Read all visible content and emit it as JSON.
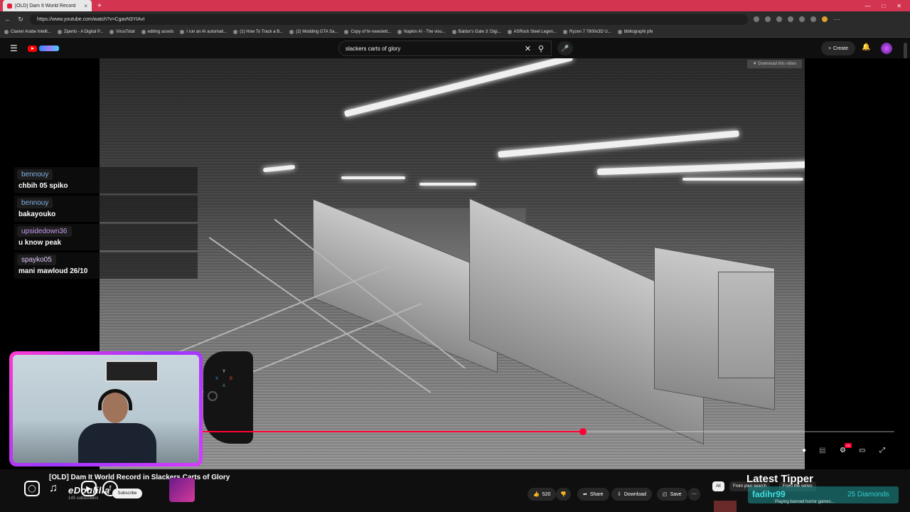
{
  "browser": {
    "tab_title": "[OLD] Dam It World Record",
    "tab_close": "×",
    "new_tab": "+",
    "url": "https://www.youtube.com/watch?v=CgavN3YIAvI",
    "bookmarks": [
      "Clavier Arabe Intelli...",
      "Ziperto - A Digital P...",
      "VirusTotal",
      "editing assets",
      "I run an AI automati...",
      "(1) How To Track a B...",
      "(2) Modding GTA Sa...",
      "Copy of hr-newslett...",
      "Napkin AI - The visu...",
      "Baldur's Gate 3: Digi...",
      "ASRock Steel Legen...",
      "Ryzen 7 7800x3D U...",
      "bibliographi pfe"
    ]
  },
  "youtube": {
    "search_query": "slackers carts of glory",
    "create_label": "Create",
    "download_overlay": "Download this video",
    "hd_badge": "HD"
  },
  "player": {
    "progress_fraction": 0.608
  },
  "chat": [
    {
      "user": "bennouy",
      "message": "chbih 05 spiko",
      "color": "#7fb2e5"
    },
    {
      "user": "bennouy",
      "message": "bakayouko",
      "color": "#7fb2e5"
    },
    {
      "user": "upsidedown36",
      "message": "u know peak",
      "color": "#c39cf0"
    },
    {
      "user": "spayko05",
      "message": "mani mawloud 26/10",
      "color": "#e0c8f8"
    }
  ],
  "controller_buttons": [
    "Y",
    "X",
    "B",
    "A"
  ],
  "video_info": {
    "title": "[OLD] Dam It World Record in Slackers Carts of Glory",
    "channel": "eDoulilla",
    "subscribers": "145 subscribers",
    "subscribe_label": "Subscribe",
    "like_count": "520",
    "share_label": "Share",
    "download_label": "Download",
    "save_label": "Save"
  },
  "sidebar": {
    "chips": [
      "All",
      "From your search",
      "From the series"
    ],
    "rec_title": "Playing banned horror games..."
  },
  "tipper": {
    "heading": "Latest Tipper",
    "name": "fadihr99",
    "amount": "25 Diamonds"
  }
}
